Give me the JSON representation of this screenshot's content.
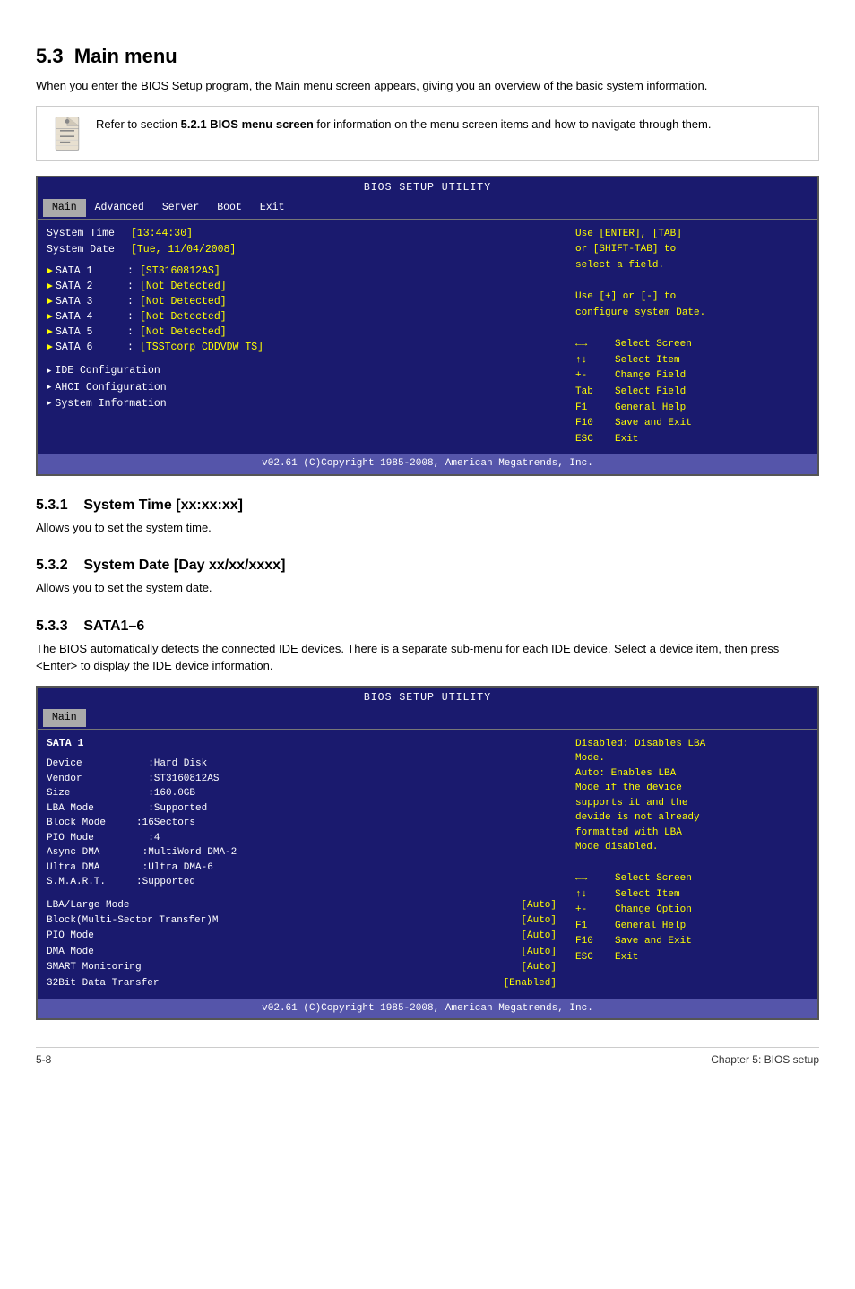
{
  "page": {
    "section_number": "5.3",
    "section_title": "Main menu",
    "intro_text": "When you enter the BIOS Setup program, the Main menu screen appears, giving you an overview of the basic system information.",
    "note": {
      "text": "Refer to section 5.2.1 BIOS menu screen for information on the menu screen items and how to navigate through them.",
      "bold_part": "5.2.1 BIOS menu screen"
    }
  },
  "bios1": {
    "title": "BIOS SETUP UTILITY",
    "menu_items": [
      "Main",
      "Advanced",
      "Server",
      "Boot",
      "Exit"
    ],
    "active_menu": "Main",
    "system_time_label": "System Time",
    "system_time_value": "[13:44:30]",
    "system_date_label": "System Date",
    "system_date_value": "[Tue, 11/04/2008]",
    "sata_items": [
      {
        "label": "SATA 1",
        "colon": ":",
        "value": "[ST3160812AS]"
      },
      {
        "label": "SATA 2",
        "colon": ":",
        "value": "[Not Detected]"
      },
      {
        "label": "SATA 3",
        "colon": ":",
        "value": "[Not Detected]"
      },
      {
        "label": "SATA 4",
        "colon": ":",
        "value": "[Not Detected]"
      },
      {
        "label": "SATA 5",
        "colon": ":",
        "value": "[Not Detected]"
      },
      {
        "label": "SATA 6",
        "colon": ":",
        "value": "[TSSTcorp CDDVDW TS]"
      }
    ],
    "submenu_items": [
      "IDE Configuration",
      "AHCI Configuration",
      "System Information"
    ],
    "right_text_line1": "Use [ENTER], [TAB]",
    "right_text_line2": "or [SHIFT-TAB] to",
    "right_text_line3": "select a field.",
    "right_text_line4": "",
    "right_text_line5": "Use [+] or [-] to",
    "right_text_line6": "configure system Date.",
    "nav": [
      {
        "key": "←→",
        "desc": "Select Screen"
      },
      {
        "key": "↑↓",
        "desc": "Select Item"
      },
      {
        "key": "+-",
        "desc": "Change Field"
      },
      {
        "key": "Tab",
        "desc": "Select Field"
      },
      {
        "key": "F1",
        "desc": "General Help"
      },
      {
        "key": "F10",
        "desc": "Save and Exit"
      },
      {
        "key": "ESC",
        "desc": "Exit"
      }
    ],
    "footer": "v02.61 (C)Copyright 1985-2008, American Megatrends, Inc."
  },
  "sub531": {
    "number": "5.3.1",
    "title": "System Time [xx:xx:xx]",
    "body": "Allows you to set the system time."
  },
  "sub532": {
    "number": "5.3.2",
    "title": "System Date [Day xx/xx/xxxx]",
    "body": "Allows you to set the system date."
  },
  "sub533": {
    "number": "5.3.3",
    "title": "SATA1–6",
    "body": "The BIOS automatically detects the connected IDE devices. There is a separate sub-menu for each IDE device. Select a device item, then press <Enter> to display the IDE device information."
  },
  "bios2": {
    "title": "BIOS SETUP UTILITY",
    "active_menu": "Main",
    "sata_header": "SATA 1",
    "device_info": [
      {
        "key": "Device",
        "sep": "  :Hard Disk"
      },
      {
        "key": "Vendor",
        "sep": "  :ST3160812AS"
      },
      {
        "key": "Size",
        "sep": "  :160.0GB"
      },
      {
        "key": "LBA Mode",
        "sep": "  :Supported"
      },
      {
        "key": "Block Mode",
        "sep": ":16Sectors"
      },
      {
        "key": "PIO Mode",
        "sep": "  :4"
      },
      {
        "key": "Async DMA",
        "sep": " :MultiWord DMA-2"
      },
      {
        "key": "Ultra DMA",
        "sep": " :Ultra DMA-6"
      },
      {
        "key": "S.M.A.R.T.",
        "sep": ":Supported"
      }
    ],
    "options": [
      {
        "label": "LBA/Large Mode",
        "value": "[Auto]"
      },
      {
        "label": "Block(Multi-Sector Transfer)M",
        "value": "[Auto]"
      },
      {
        "label": "PIO Mode",
        "value": "[Auto]"
      },
      {
        "label": "DMA Mode",
        "value": "[Auto]"
      },
      {
        "label": "SMART Monitoring",
        "value": "[Auto]"
      },
      {
        "label": "32Bit Data Transfer",
        "value": "[Enabled]"
      }
    ],
    "right_disabled_text": "Disabled: Disables LBA\nMode.\nAuto: Enables LBA\nMode if the device\nsupports it and the\ndevide is not already\nformatted with LBA\nMode disabled.",
    "nav": [
      {
        "key": "←→",
        "desc": "Select Screen"
      },
      {
        "key": "↑↓",
        "desc": "Select Item"
      },
      {
        "key": "+-",
        "desc": "Change Option"
      },
      {
        "key": "F1",
        "desc": "General Help"
      },
      {
        "key": "F10",
        "desc": "Save and Exit"
      },
      {
        "key": "ESC",
        "desc": "Exit"
      }
    ],
    "footer": "v02.61 (C)Copyright 1985-2008, American Megatrends, Inc."
  },
  "footer": {
    "left": "5-8",
    "right": "Chapter 5: BIOS setup"
  }
}
